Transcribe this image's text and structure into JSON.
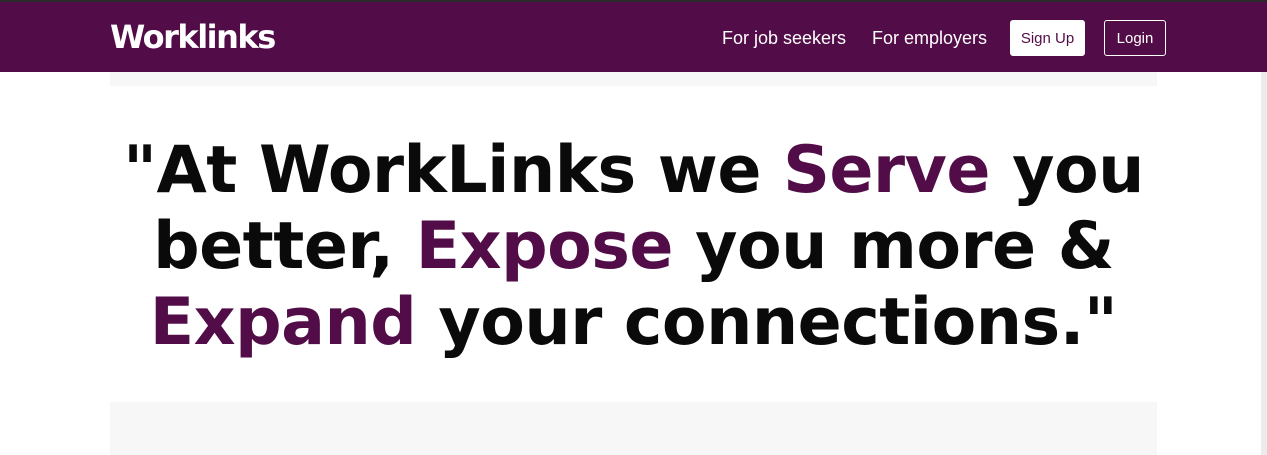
{
  "header": {
    "logo_text": "Worklinks",
    "nav": {
      "job_seekers": "For job seekers",
      "employers": "For employers"
    },
    "buttons": {
      "signup": "Sign Up",
      "login": "Login"
    }
  },
  "hero": {
    "line1": {
      "pre": "\"At WorkLinks we ",
      "highlight": "Serve",
      "post": " you"
    },
    "line2": {
      "pre": "better, ",
      "highlight": "Expose",
      "post": " you more &"
    },
    "line3": {
      "pre": "",
      "highlight": "Expand",
      "post": " your connections.\""
    }
  },
  "colors": {
    "brand": "#520c47",
    "text": "#0a0a0a",
    "background": "#ffffff",
    "band": "#f7f7f7"
  }
}
